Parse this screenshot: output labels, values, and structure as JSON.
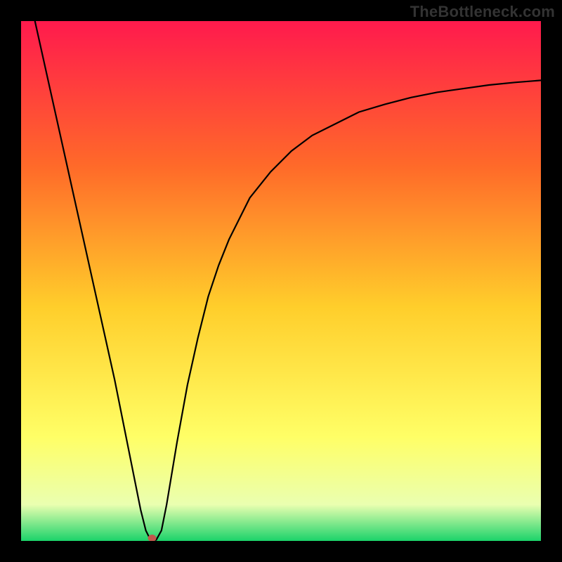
{
  "watermark": "TheBottleneck.com",
  "colors": {
    "frame": "#000000",
    "gradient_top": "#ff1a4d",
    "gradient_mid_upper": "#ff6a29",
    "gradient_mid": "#ffce2b",
    "gradient_lower": "#ffff66",
    "gradient_light": "#eaffb0",
    "gradient_bottom": "#1bd36a",
    "curve": "#000000",
    "marker": "#c1584c"
  },
  "chart_data": {
    "type": "line",
    "title": "",
    "xlabel": "",
    "ylabel": "",
    "xlim": [
      0,
      100
    ],
    "ylim": [
      0,
      100
    ],
    "x": [
      0,
      2,
      4,
      6,
      8,
      10,
      12,
      14,
      16,
      18,
      20,
      22,
      23,
      24,
      25,
      26,
      27,
      28,
      30,
      32,
      34,
      36,
      38,
      40,
      44,
      48,
      52,
      56,
      60,
      65,
      70,
      75,
      80,
      85,
      90,
      95,
      100
    ],
    "y": [
      112,
      103,
      94,
      85,
      76,
      67,
      58,
      49,
      40,
      31,
      21,
      11,
      6,
      2,
      0,
      0.2,
      2,
      7,
      19,
      30,
      39,
      47,
      53,
      58,
      66,
      71,
      75,
      78,
      80,
      82.5,
      84,
      85.3,
      86.3,
      87,
      87.7,
      88.2,
      88.6
    ],
    "optimum_x": 25.2,
    "gradient_stops": [
      {
        "pos": 0.0,
        "label": "red"
      },
      {
        "pos": 0.28,
        "label": "orange-red"
      },
      {
        "pos": 0.55,
        "label": "orange-yellow"
      },
      {
        "pos": 0.8,
        "label": "yellow"
      },
      {
        "pos": 0.93,
        "label": "light-yellow-green"
      },
      {
        "pos": 1.0,
        "label": "green"
      }
    ]
  }
}
